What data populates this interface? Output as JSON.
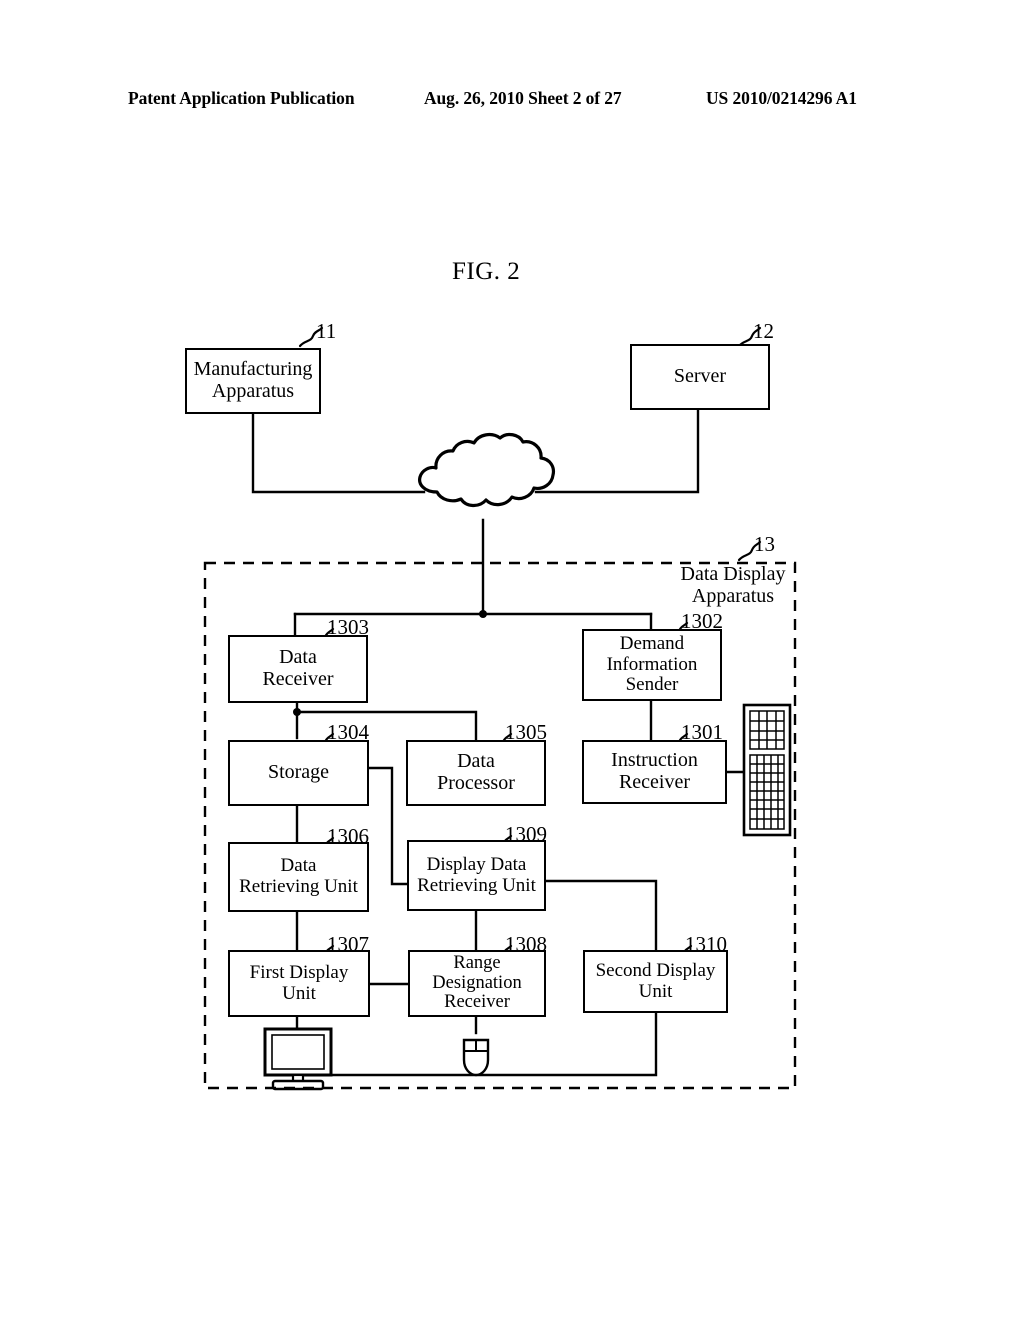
{
  "header": {
    "left": "Patent Application Publication",
    "middle": "Aug. 26, 2010  Sheet 2 of 27",
    "right": "US 2010/0214296 A1"
  },
  "figure": {
    "title": "FIG. 2",
    "container_label": "Data Display\nApparatus",
    "container_ref": "13"
  },
  "nodes": {
    "manufacturing_apparatus": {
      "label": "Manufacturing\nApparatus",
      "ref": "11"
    },
    "server": {
      "label": "Server",
      "ref": "12"
    },
    "data_receiver": {
      "label": "Data\nReceiver",
      "ref": "1303"
    },
    "demand_information_sender": {
      "label": "Demand\nInformation\nSender",
      "ref": "1302"
    },
    "storage": {
      "label": "Storage",
      "ref": "1304"
    },
    "data_processor": {
      "label": "Data\nProcessor",
      "ref": "1305"
    },
    "instruction_receiver": {
      "label": "Instruction\nReceiver",
      "ref": "1301"
    },
    "data_retrieving_unit": {
      "label": "Data\nRetrieving Unit",
      "ref": "1306"
    },
    "display_data_retrieving_unit": {
      "label": "Display Data\nRetrieving Unit",
      "ref": "1309"
    },
    "first_display_unit": {
      "label": "First Display\nUnit",
      "ref": "1307"
    },
    "range_designation_receiver": {
      "label": "Range\nDesignation\nReceiver",
      "ref": "1308"
    },
    "second_display_unit": {
      "label": "Second Display\nUnit",
      "ref": "1310"
    }
  },
  "icons": {
    "network_cloud": "cloud-icon",
    "keyboard": "keyboard-icon",
    "monitor": "monitor-icon",
    "mouse": "mouse-icon"
  },
  "colors": {
    "ink": "#000000",
    "paper": "#ffffff"
  }
}
